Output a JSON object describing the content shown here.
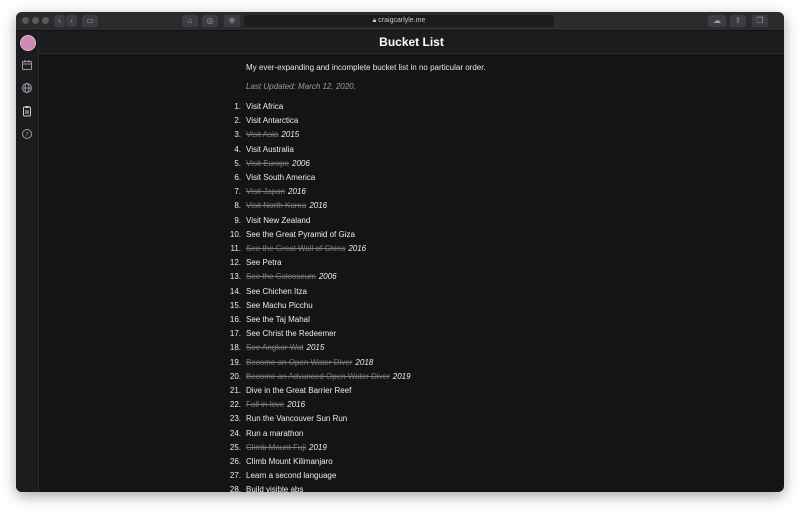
{
  "browser": {
    "url": "craigcarlyle.me"
  },
  "page": {
    "title": "Bucket List",
    "intro": "My ever-expanding and incomplete bucket list in no particular order.",
    "updated": "Last Updated: March 12, 2020."
  },
  "items": [
    {
      "num": "1.",
      "text": "Visit Africa",
      "done": false,
      "year": ""
    },
    {
      "num": "2.",
      "text": "Visit Antarctica",
      "done": false,
      "year": ""
    },
    {
      "num": "3.",
      "text": "Visit Asia",
      "done": true,
      "year": "2015"
    },
    {
      "num": "4.",
      "text": "Visit Australia",
      "done": false,
      "year": ""
    },
    {
      "num": "5.",
      "text": "Visit Europe",
      "done": true,
      "year": "2006"
    },
    {
      "num": "6.",
      "text": "Visit South America",
      "done": false,
      "year": ""
    },
    {
      "num": "7.",
      "text": "Visit Japan",
      "done": true,
      "year": "2016"
    },
    {
      "num": "8.",
      "text": "Visit North Korea",
      "done": true,
      "year": "2016"
    },
    {
      "num": "9.",
      "text": "Visit New Zealand",
      "done": false,
      "year": ""
    },
    {
      "num": "10.",
      "text": "See the Great Pyramid of Giza",
      "done": false,
      "year": ""
    },
    {
      "num": "11.",
      "text": "See the Great Wall of China",
      "done": true,
      "year": "2016"
    },
    {
      "num": "12.",
      "text": "See Petra",
      "done": false,
      "year": ""
    },
    {
      "num": "13.",
      "text": "See the Colosseum",
      "done": true,
      "year": "2006"
    },
    {
      "num": "14.",
      "text": "See Chichen Itza",
      "done": false,
      "year": ""
    },
    {
      "num": "15.",
      "text": "See Machu Picchu",
      "done": false,
      "year": ""
    },
    {
      "num": "16.",
      "text": "See the Taj Mahal",
      "done": false,
      "year": ""
    },
    {
      "num": "17.",
      "text": "See Christ the Redeemer",
      "done": false,
      "year": ""
    },
    {
      "num": "18.",
      "text": "See Angkor Wat",
      "done": true,
      "year": "2015"
    },
    {
      "num": "19.",
      "text": "Become an Open Water Diver",
      "done": true,
      "year": "2018"
    },
    {
      "num": "20.",
      "text": "Become an Advanced Open Water Diver",
      "done": true,
      "year": "2019"
    },
    {
      "num": "21.",
      "text": "Dive in the Great Barrier Reef",
      "done": false,
      "year": ""
    },
    {
      "num": "22.",
      "text": "Fall in love",
      "done": true,
      "year": "2016"
    },
    {
      "num": "23.",
      "text": "Run the Vancouver Sun Run",
      "done": false,
      "year": ""
    },
    {
      "num": "24.",
      "text": "Run a marathon",
      "done": false,
      "year": ""
    },
    {
      "num": "25.",
      "text": "Climb Mount Fuji",
      "done": true,
      "year": "2019"
    },
    {
      "num": "26.",
      "text": "Climb Mount Kilimanjaro",
      "done": false,
      "year": ""
    },
    {
      "num": "27.",
      "text": "Learn a second language",
      "done": false,
      "year": ""
    },
    {
      "num": "28.",
      "text": "Build visible abs",
      "done": false,
      "year": ""
    }
  ],
  "colors": {
    "background": "#141416",
    "text": "#ececec",
    "completed": "#7c7c80",
    "avatar": "#c98bb0"
  },
  "icons": {
    "sidebar": [
      "avatar",
      "calendar-icon",
      "globe-icon",
      "clipboard-icon",
      "help-icon"
    ]
  }
}
